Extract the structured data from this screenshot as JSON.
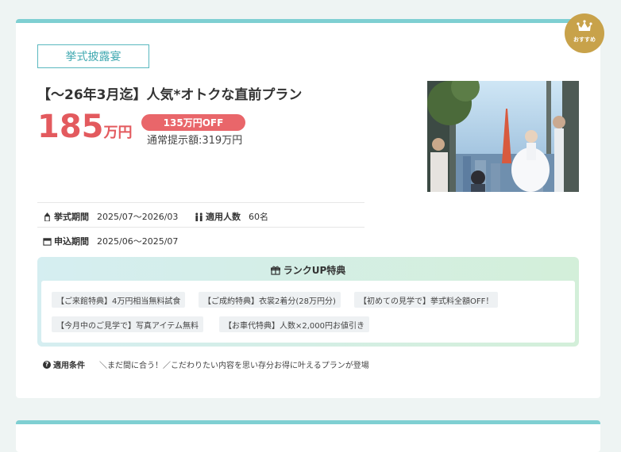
{
  "plan": {
    "category": "挙式披露宴",
    "title": "【～26年3月迄】人気*オトクな直前プラン",
    "price_number": "185",
    "price_unit": "万円",
    "discount": "135万円OFF",
    "regular_price": "通常提示額:319万円",
    "photo_icon": "wedding-photo"
  },
  "badge": {
    "label": "おすすめ",
    "icon": "crown-icon"
  },
  "info": {
    "ceremony_period_label": "挙式期間",
    "ceremony_period_value": "2025/07～2026/03",
    "guests_label": "適用人数",
    "guests_value": "60名",
    "application_period_label": "申込期間",
    "application_period_value": "2025/06～2025/07"
  },
  "rankup": {
    "title": "ランクUP特典",
    "tags": [
      "【ご来館特典】4万円相当無料試食",
      "【ご成約特典】衣裳2着分(28万円分)",
      "【初めての見学で】挙式料全額OFF！",
      "【今月中のご見学で】写真アイテム無料",
      "【お車代特典】人数×2,000円お値引き"
    ]
  },
  "conditions": {
    "label": "適用条件",
    "text": "＼まだ間に合う！／こだわりたい内容を思い存分お得に叶えるプランが登場"
  },
  "colors": {
    "accent_teal": "#7fcfd2",
    "price_red": "#e35a5e",
    "badge_gold": "#c8a24a"
  }
}
